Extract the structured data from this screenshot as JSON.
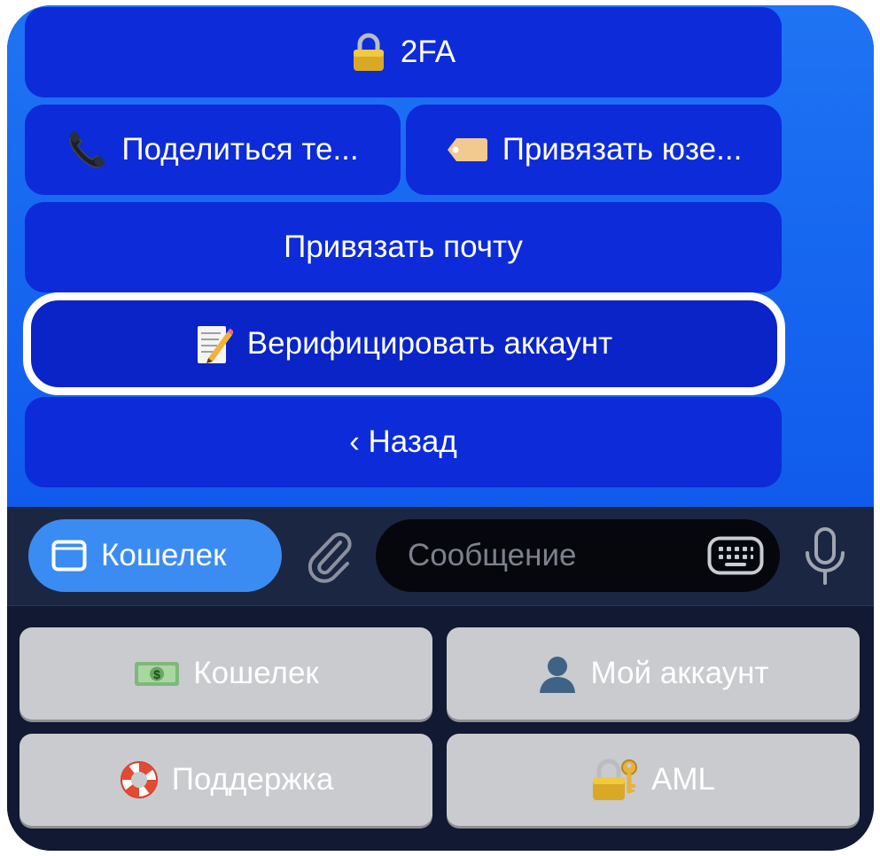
{
  "inline_keyboard": {
    "two_fa": {
      "label": "2FA",
      "icon": "lock-icon"
    },
    "share_phone": {
      "label": "Поделиться те...",
      "icon": "telephone-receiver-icon"
    },
    "link_username": {
      "label": "Привязать юзе...",
      "icon": "label-tag-icon"
    },
    "link_email": {
      "label": "Привязать почту"
    },
    "verify_account": {
      "label": "Верифицировать аккаунт",
      "icon": "memo-pencil-icon",
      "highlighted": true
    },
    "back": {
      "label": "‹ Назад"
    }
  },
  "input_bar": {
    "menu_button_label": "Кошелек",
    "message_placeholder": "Сообщение"
  },
  "reply_keyboard": {
    "wallet": {
      "label": "Кошелек",
      "icon": "money-banknote-icon"
    },
    "my_account": {
      "label": "Мой аккаунт",
      "icon": "user-silhouette-icon"
    },
    "support": {
      "label": "Поддержка",
      "icon": "lifebuoy-icon"
    },
    "aml": {
      "label": "AML",
      "icon": "lock-with-key-icon"
    }
  },
  "colors": {
    "chat_background": "#1768f0",
    "inline_button": "#0d2bd9",
    "menu_button": "#3b8cf2",
    "input_bar": "#1b2642",
    "reply_keyboard_bg": "#111933",
    "reply_button": "#c9cbcf"
  }
}
